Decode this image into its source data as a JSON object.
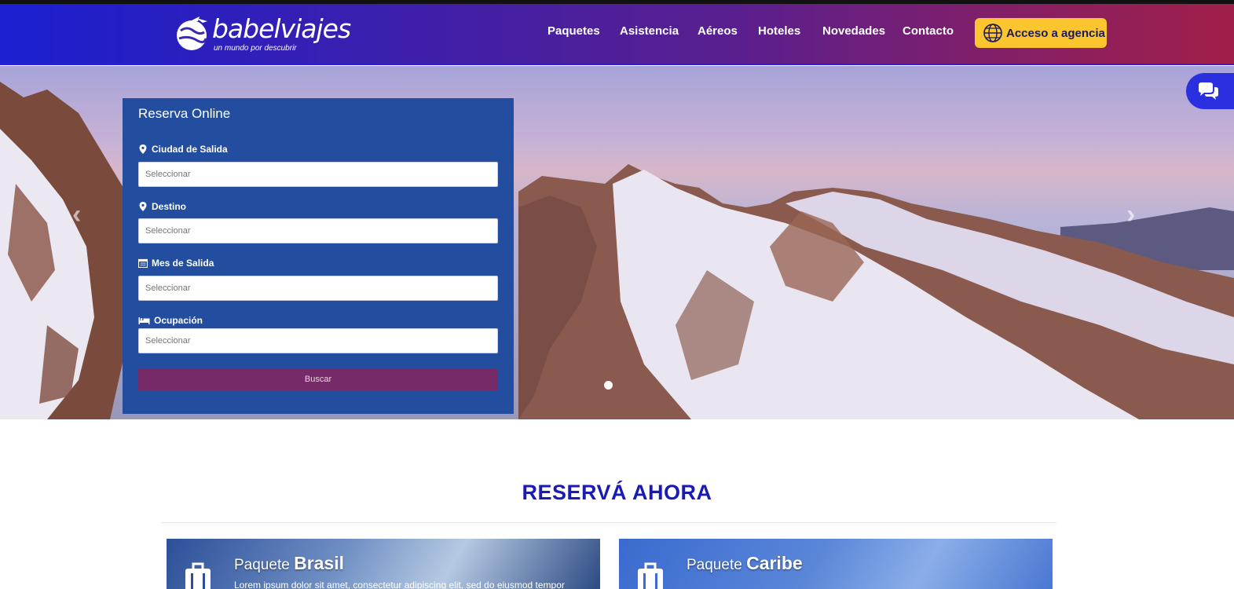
{
  "header": {
    "logo_text": "babelviajes",
    "logo_tagline": "un mundo por descubrir",
    "nav": [
      "Paquetes",
      "Asistencia",
      "Aéreos",
      "Hoteles",
      "Novedades",
      "Contacto"
    ],
    "agency_button": "Acceso a agencia",
    "agency_icon": "globe-icon"
  },
  "booking": {
    "title": "Reserva Online",
    "fields": [
      {
        "label": "Ciudad de Salida",
        "placeholder": "Seleccionar",
        "icon": "map-marker-icon"
      },
      {
        "label": "Destino",
        "placeholder": "Seleccionar",
        "icon": "map-marker-icon"
      },
      {
        "label": "Mes de Salida",
        "placeholder": "Seleccionar",
        "icon": "calendar-icon"
      },
      {
        "label": "Ocupación",
        "placeholder": "Seleccionar",
        "icon": "bed-icon"
      }
    ],
    "search_button": "Buscar"
  },
  "carousel": {
    "prev_icon": "chevron-left-icon",
    "next_icon": "chevron-right-icon",
    "prev_glyph": "‹",
    "next_glyph": "›"
  },
  "chat": {
    "icon": "chat-bubbles-icon"
  },
  "section": {
    "title": "RESERVÁ AHORA"
  },
  "cards": [
    {
      "prefix": "Paquete",
      "name": "Brasil",
      "description": "Lorem ipsum dolor sit amet, consectetur adipiscing elit, sed do eiusmod tempor"
    },
    {
      "prefix": "Paquete",
      "name": "Caribe",
      "description": ""
    }
  ],
  "colors": {
    "header_gradient_start": "#1a1fd0",
    "header_gradient_end": "#a01f4a",
    "agency_button": "#fbc530",
    "panel": "#234ea0",
    "search_button": "#772a68",
    "section_title": "#1a1ab4"
  }
}
